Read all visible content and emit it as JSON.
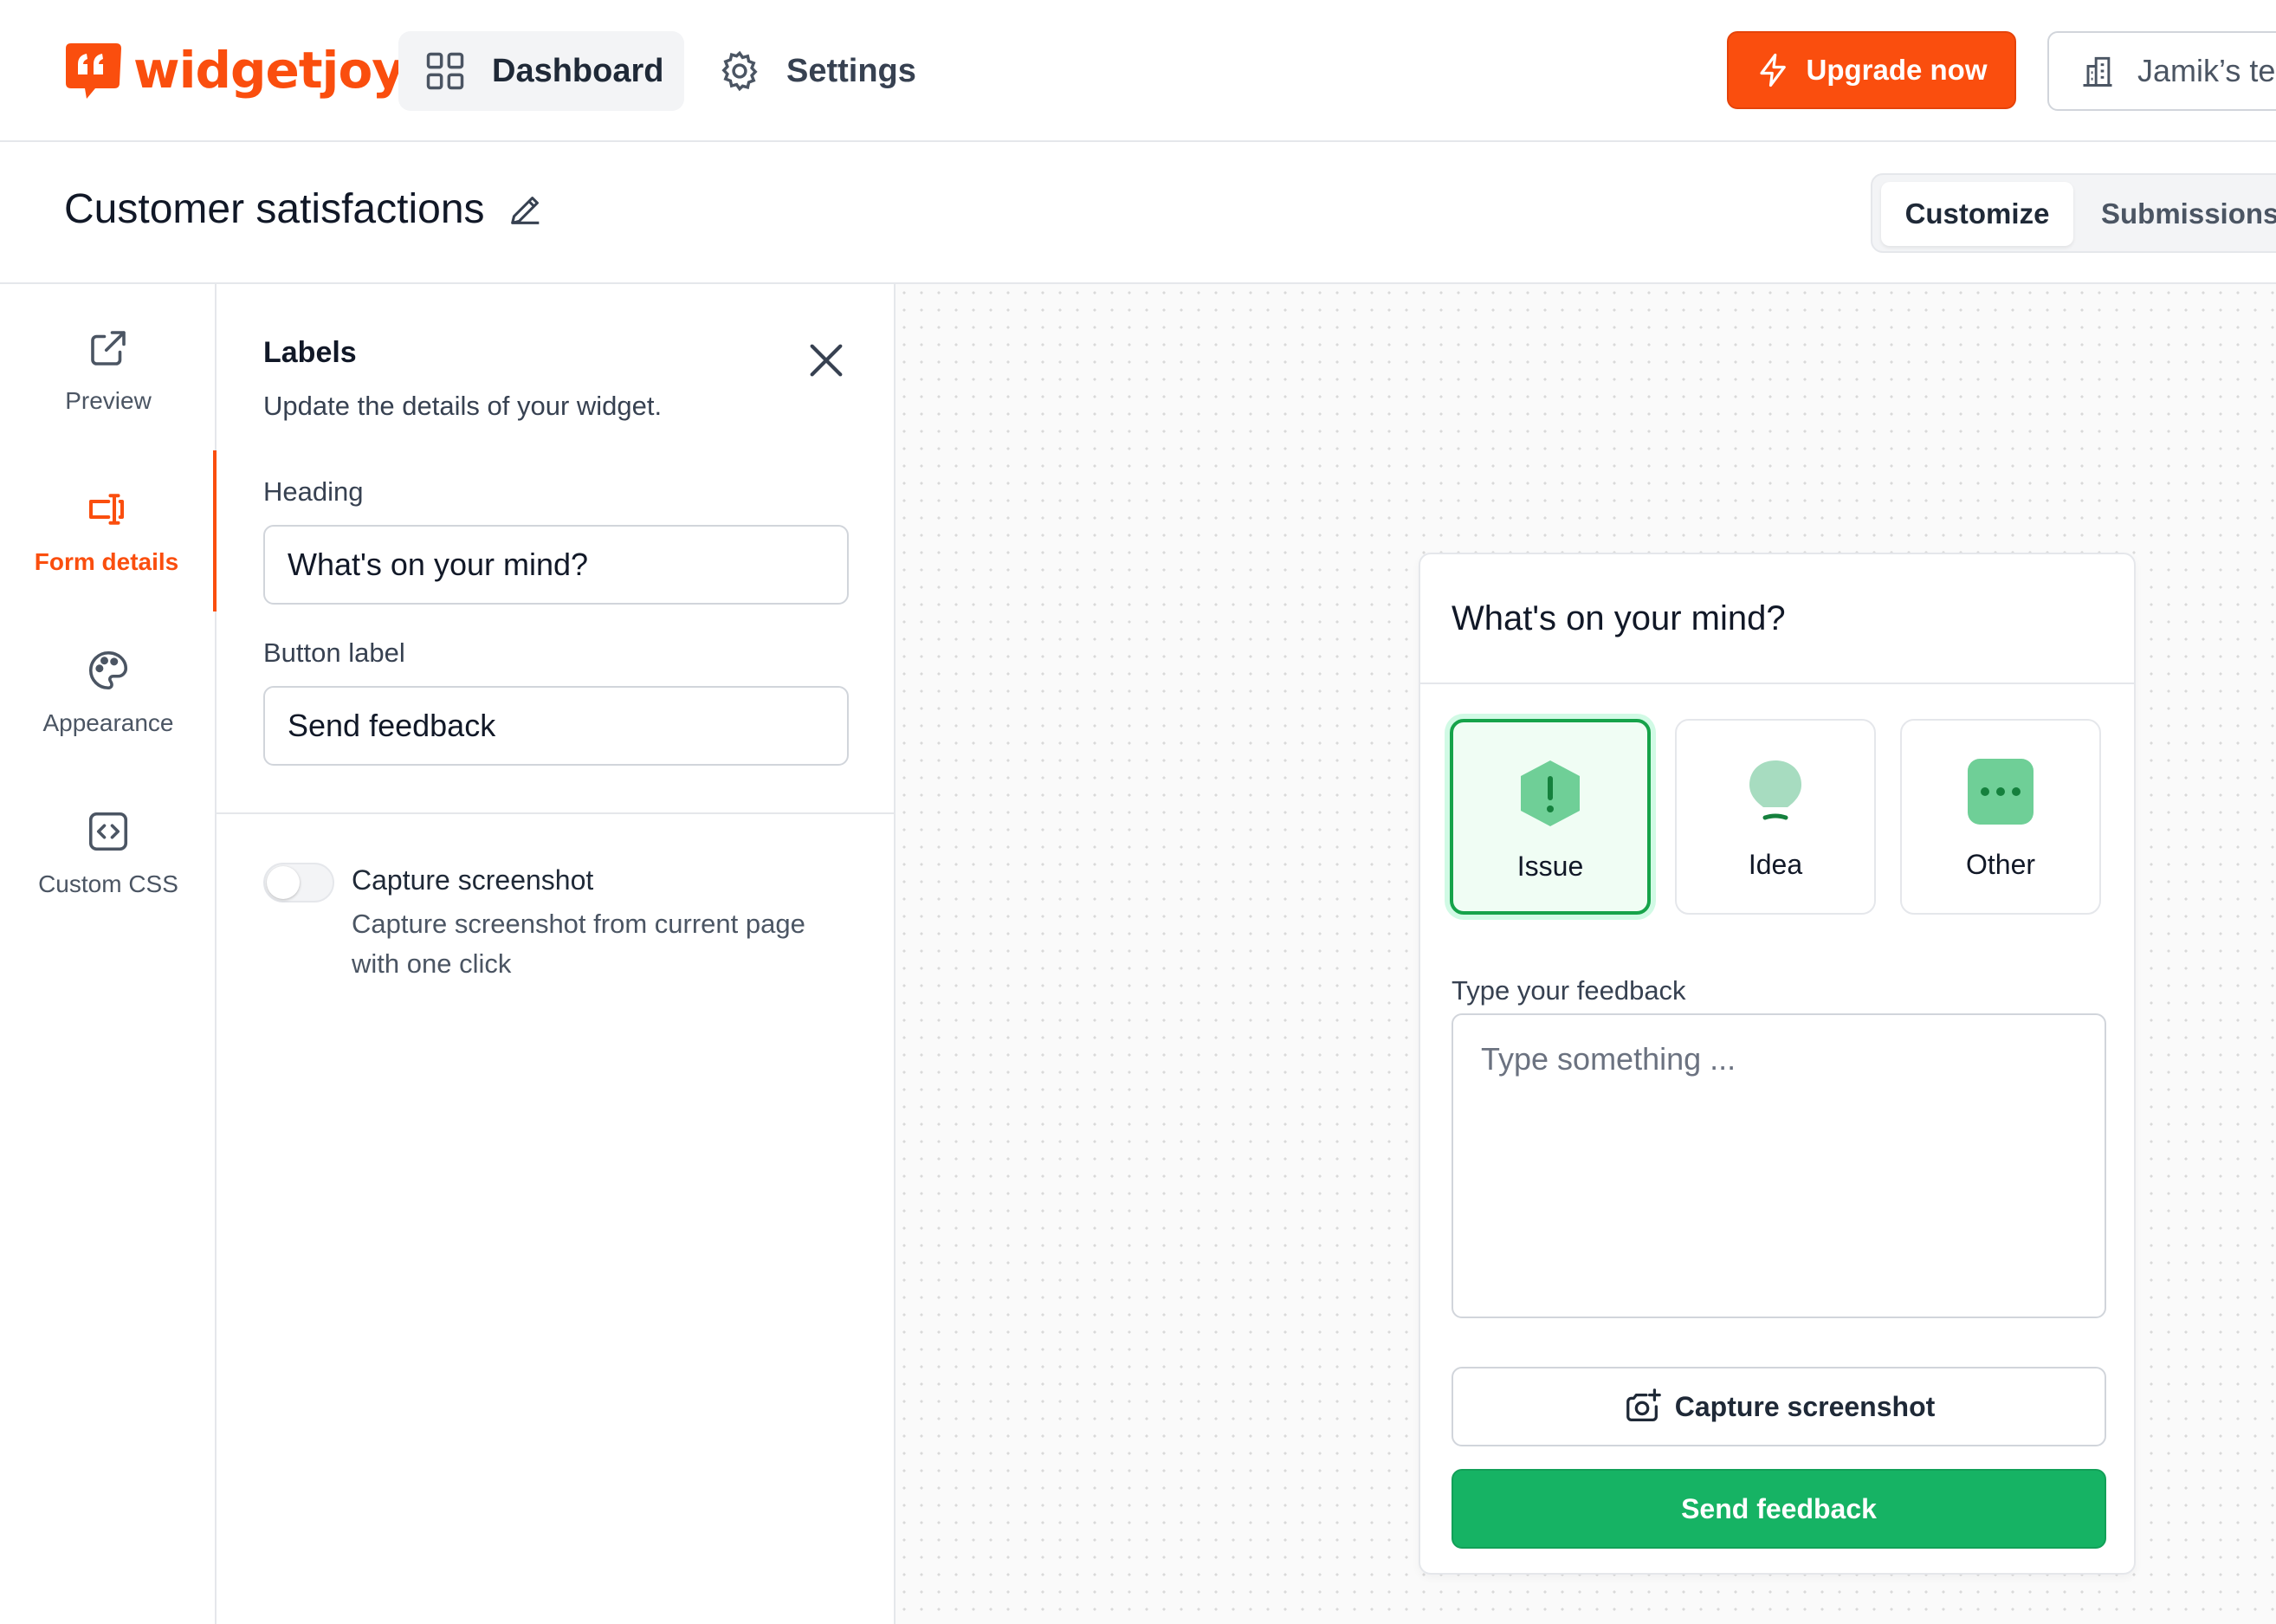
{
  "app": {
    "brand": "widgetjoy",
    "accent_color": "#fa4e0e",
    "success_color": "#16b364"
  },
  "nav": {
    "dashboard_label": "Dashboard",
    "settings_label": "Settings",
    "upgrade_label": "Upgrade now",
    "team_label": "Jamik’s te"
  },
  "page": {
    "title": "Customer satisfactions",
    "tabs": [
      {
        "label": "Customize",
        "active": true
      },
      {
        "label": "Submissions",
        "active": false
      }
    ]
  },
  "sidebar": {
    "items": [
      {
        "label": "Preview",
        "icon": "external-link-icon",
        "active": false
      },
      {
        "label": "Form details",
        "icon": "form-input-icon",
        "active": true
      },
      {
        "label": "Appearance",
        "icon": "palette-icon",
        "active": false
      },
      {
        "label": "Custom CSS",
        "icon": "code-icon",
        "active": false
      }
    ]
  },
  "panel": {
    "title": "Labels",
    "description": "Update the details of your widget.",
    "heading_label": "Heading",
    "heading_value": "What's on your mind?",
    "button_label_label": "Button label",
    "button_label_value": "Send feedback",
    "capture_toggle": {
      "title": "Capture screenshot",
      "description": "Capture screenshot from current page with one click",
      "enabled": false
    }
  },
  "widget": {
    "heading": "What's on your mind?",
    "categories": [
      {
        "label": "Issue",
        "icon": "alert-hexagon-icon",
        "selected": true
      },
      {
        "label": "Idea",
        "icon": "lightbulb-icon",
        "selected": false
      },
      {
        "label": "Other",
        "icon": "dots-icon",
        "selected": false
      }
    ],
    "feedback_label": "Type your feedback",
    "feedback_placeholder": "Type something ...",
    "capture_button": "Capture screenshot",
    "send_button": "Send feedback"
  }
}
